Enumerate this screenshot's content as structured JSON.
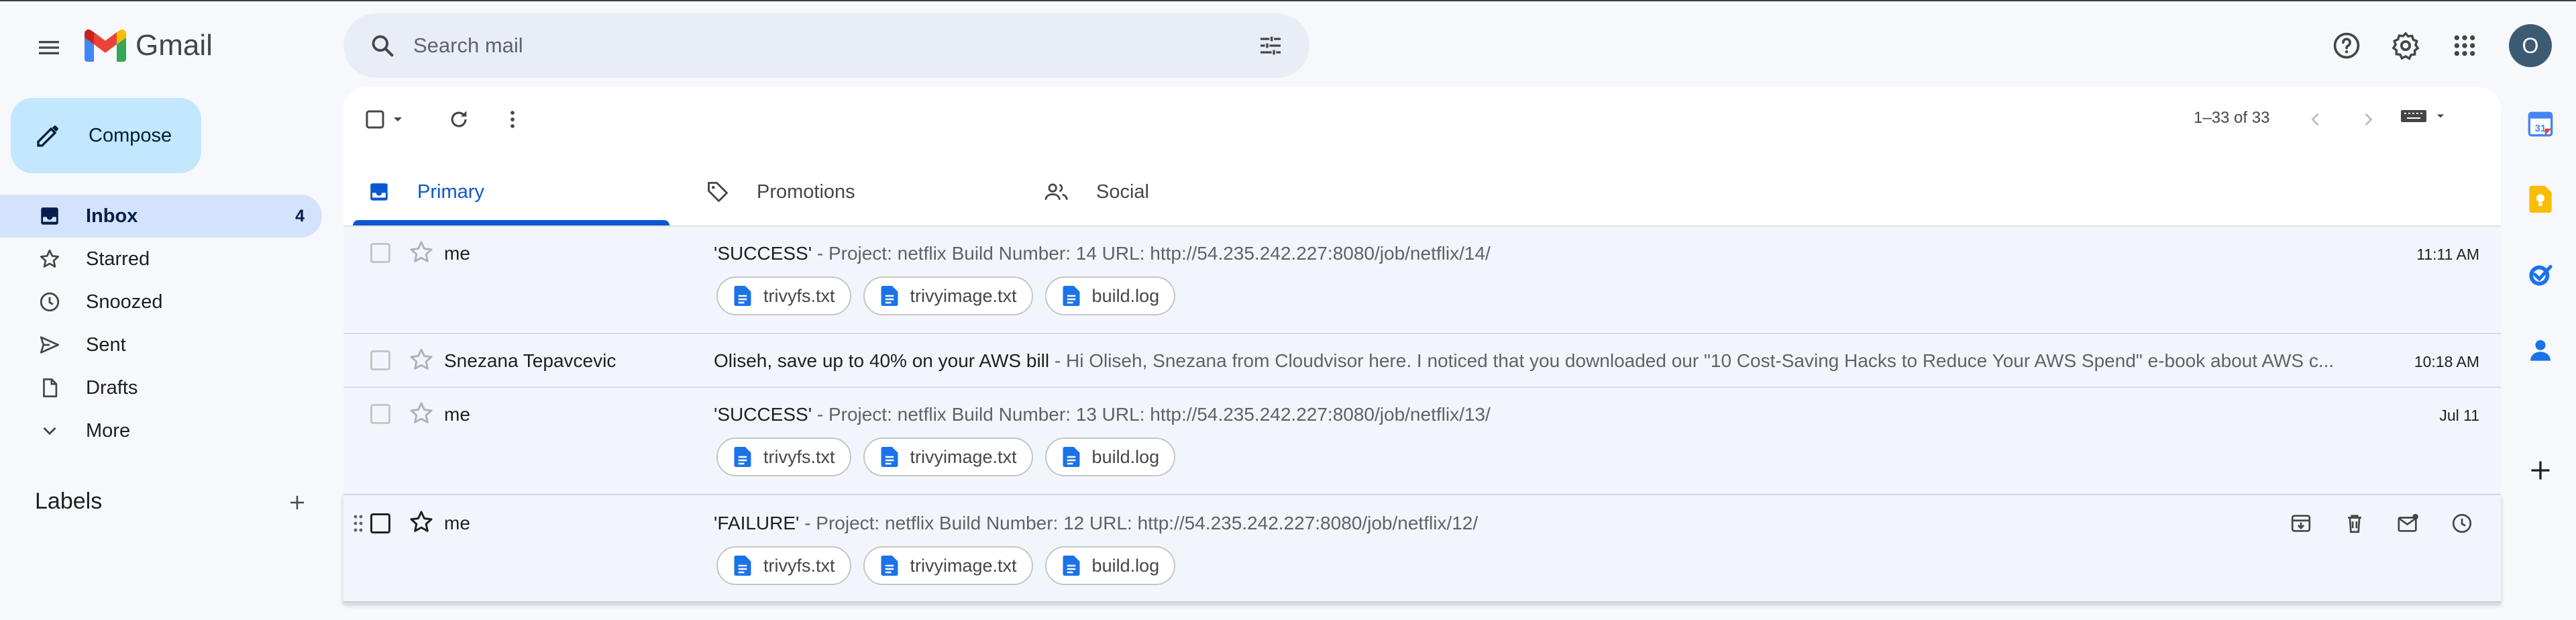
{
  "app": {
    "name": "Gmail"
  },
  "search": {
    "placeholder": "Search mail"
  },
  "account": {
    "initial": "O"
  },
  "compose": {
    "label": "Compose"
  },
  "sidebar": {
    "items": [
      {
        "label": "Inbox",
        "count": "4",
        "icon": "inbox-icon",
        "active": true
      },
      {
        "label": "Starred",
        "icon": "star-icon"
      },
      {
        "label": "Snoozed",
        "icon": "clock-icon"
      },
      {
        "label": "Sent",
        "icon": "send-icon"
      },
      {
        "label": "Drafts",
        "icon": "draft-icon"
      },
      {
        "label": "More",
        "icon": "chevron-down-icon"
      }
    ],
    "labels_title": "Labels"
  },
  "toolbar": {
    "pager": "1–33 of 33"
  },
  "tabs": [
    {
      "label": "Primary",
      "icon": "inbox-icon",
      "active": true
    },
    {
      "label": "Promotions",
      "icon": "tag-icon"
    },
    {
      "label": "Social",
      "icon": "people-icon"
    }
  ],
  "emails": [
    {
      "sender": "me",
      "subject": "'SUCCESS'",
      "snippet": " - Project: netflix Build Number: 14 URL: http://54.235.242.227:8080/job/netflix/14/",
      "time": "11:11 AM",
      "attachments": [
        "trivyfs.txt",
        "trivyimage.txt",
        "build.log"
      ]
    },
    {
      "sender": "Snezana Tepavcevic",
      "subject": "Oliseh, save up to 40% on your AWS bill",
      "snippet": " - Hi Oliseh, Snezana from Cloudvisor here. I noticed that you downloaded our \"10 Cost-Saving Hacks to Reduce Your AWS Spend\" e-book about AWS c...",
      "time": "10:18 AM",
      "attachments": []
    },
    {
      "sender": "me",
      "subject": "'SUCCESS'",
      "snippet": " - Project: netflix Build Number: 13 URL: http://54.235.242.227:8080/job/netflix/13/",
      "time": "Jul 11",
      "attachments": [
        "trivyfs.txt",
        "trivyimage.txt",
        "build.log"
      ]
    },
    {
      "sender": "me",
      "subject": "'FAILURE'",
      "snippet": " - Project: netflix Build Number: 12 URL: http://54.235.242.227:8080/job/netflix/12/",
      "time": "",
      "attachments": [
        "trivyfs.txt",
        "trivyimage.txt",
        "build.log"
      ]
    }
  ],
  "colors": {
    "accent": "#0b57d0",
    "compose_bg": "#c2e7ff",
    "active_nav": "#d3e3fd",
    "background": "#f6f8fc",
    "attachment_icon": "#1a73e8"
  }
}
